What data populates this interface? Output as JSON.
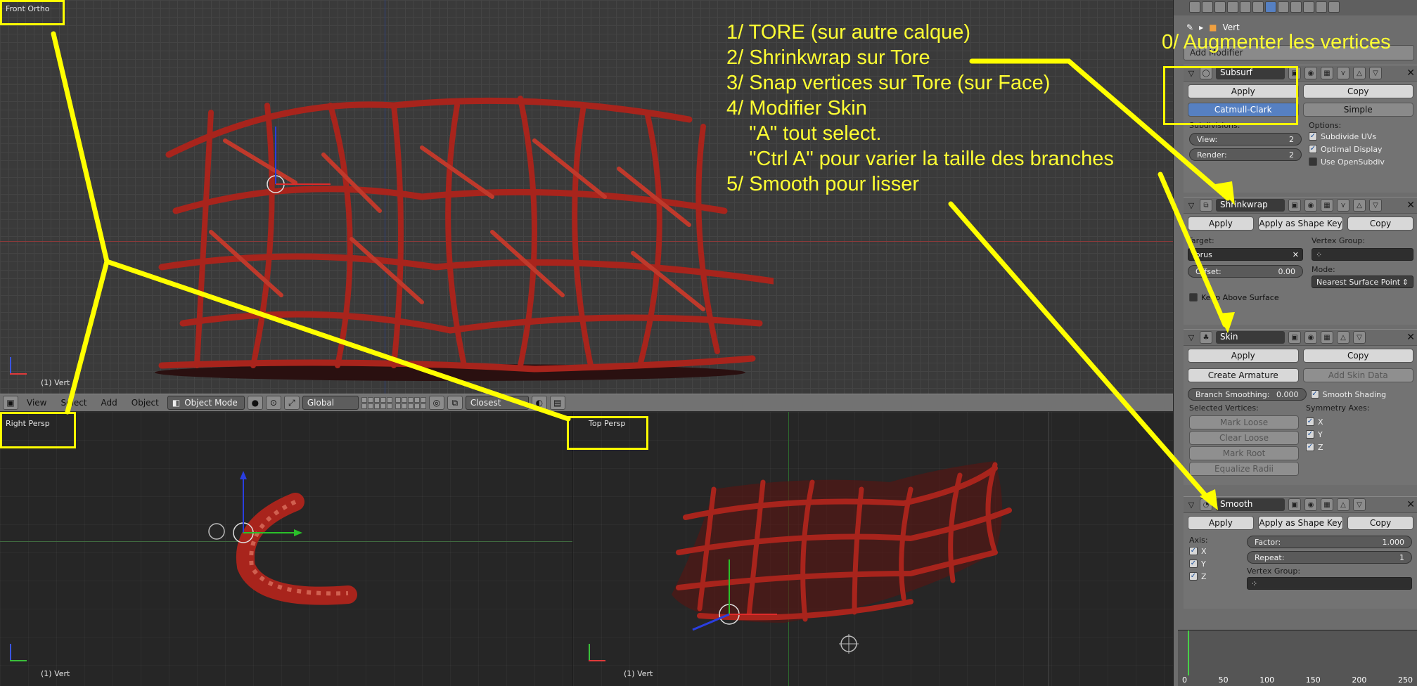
{
  "viewports": {
    "front": {
      "label": "Front Ortho",
      "footer": "(1) Vert"
    },
    "right": {
      "label": "Right Persp",
      "footer": "(1) Vert"
    },
    "top": {
      "label": "Top Persp",
      "footer": "(1) Vert"
    }
  },
  "header": {
    "menus": [
      "View",
      "Select",
      "Add",
      "Object"
    ],
    "mode": "Object Mode",
    "orientation": "Global",
    "snap": "Closest"
  },
  "panel": {
    "breadcrumb": "Vert",
    "add_modifier": "Add Modifier",
    "subsurf": {
      "name": "Subsurf",
      "apply": "Apply",
      "copy": "Copy",
      "catmull": "Catmull-Clark",
      "simple": "Simple",
      "subdivisions": "Subdivisions:",
      "options": "Options:",
      "view_label": "View:",
      "view_value": "2",
      "render_label": "Render:",
      "render_value": "2",
      "subdivide_uvs": "Subdivide UVs",
      "optimal_display": "Optimal Display",
      "use_opensubdiv": "Use OpenSubdiv"
    },
    "shrinkwrap": {
      "name": "Shrinkwrap",
      "apply": "Apply",
      "apply_shape": "Apply as Shape Key",
      "copy": "Copy",
      "target_label": "Target:",
      "target_value": "Torus",
      "vgroup_label": "Vertex Group:",
      "offset_label": "Offset:",
      "offset_value": "0.00",
      "mode_label": "Mode:",
      "mode_value": "Nearest Surface Point",
      "keep_above": "Keep Above Surface"
    },
    "skin": {
      "name": "Skin",
      "apply": "Apply",
      "copy": "Copy",
      "create_armature": "Create Armature",
      "add_skin_data": "Add Skin Data",
      "branch_label": "Branch Smoothing:",
      "branch_value": "0.000",
      "smooth_shading": "Smooth Shading",
      "selected_vertices": "Selected Vertices:",
      "symmetry_axes": "Symmetry Axes:",
      "mark_loose": "Mark Loose",
      "clear_loose": "Clear Loose",
      "mark_root": "Mark Root",
      "equalize_radii": "Equalize Radii",
      "x": "X",
      "y": "Y",
      "z": "Z"
    },
    "smooth": {
      "name": "Smooth",
      "apply": "Apply",
      "apply_shape": "Apply as Shape Key",
      "copy": "Copy",
      "axis_label": "Axis:",
      "x": "X",
      "y": "Y",
      "z": "Z",
      "factor_label": "Factor:",
      "factor_value": "1.000",
      "repeat_label": "Repeat:",
      "repeat_value": "1",
      "vgroup_label": "Vertex Group:"
    }
  },
  "timeline": {
    "ticks": [
      "0",
      "50",
      "100",
      "150",
      "200",
      "250"
    ]
  },
  "annotations": {
    "steps": "1/ TORE (sur autre calque)\n2/ Shrinkwrap sur Tore\n3/ Snap vertices sur Tore (sur Face)\n4/ Modifier Skin\n    \"A\" tout select.\n    \"Ctrl A\" pour varier la taille des branches\n5/ Smooth pour lisser",
    "step0": "0/ Augmenter les vertices"
  },
  "colors": {
    "annotation": "#ffff00",
    "mesh": "#a8241c",
    "accent": "#5680c2"
  }
}
